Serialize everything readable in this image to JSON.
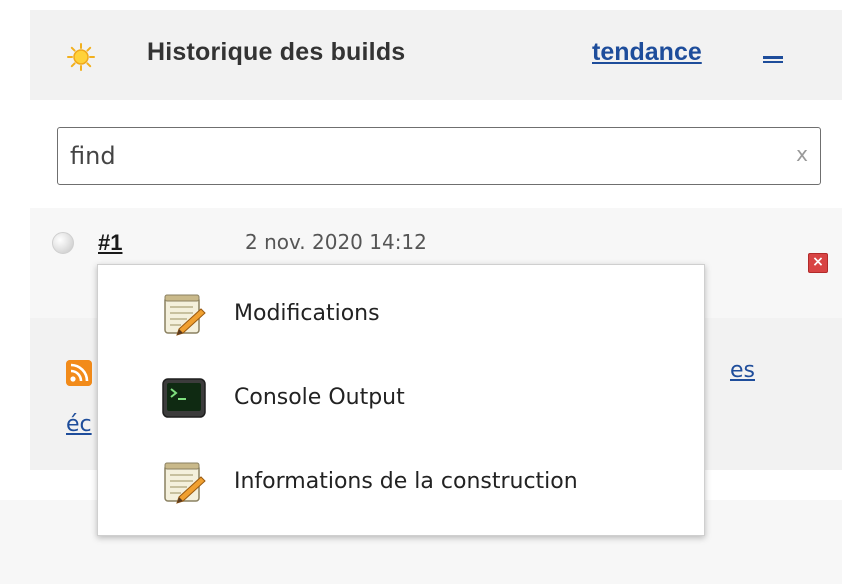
{
  "panel": {
    "title": "Historique des builds",
    "trend_label": "tendance"
  },
  "search": {
    "value": "find",
    "clear_label": "x"
  },
  "builds": [
    {
      "number": "#1",
      "date": "2 nov. 2020 14:12",
      "status": "not-built"
    }
  ],
  "feeds": {
    "link1_visible": "es",
    "link2_visible": "éc"
  },
  "context_menu": {
    "items": [
      {
        "label": "Modifications",
        "icon": "notepad-pencil-icon"
      },
      {
        "label": "Console Output",
        "icon": "terminal-icon"
      },
      {
        "label": "Informations de la construction",
        "icon": "notepad-pencil-icon"
      }
    ]
  },
  "colors": {
    "link": "#1e4d9b",
    "panel_bg": "#f2f2f2",
    "rss": "#f28b1a",
    "delete": "#d84444"
  }
}
